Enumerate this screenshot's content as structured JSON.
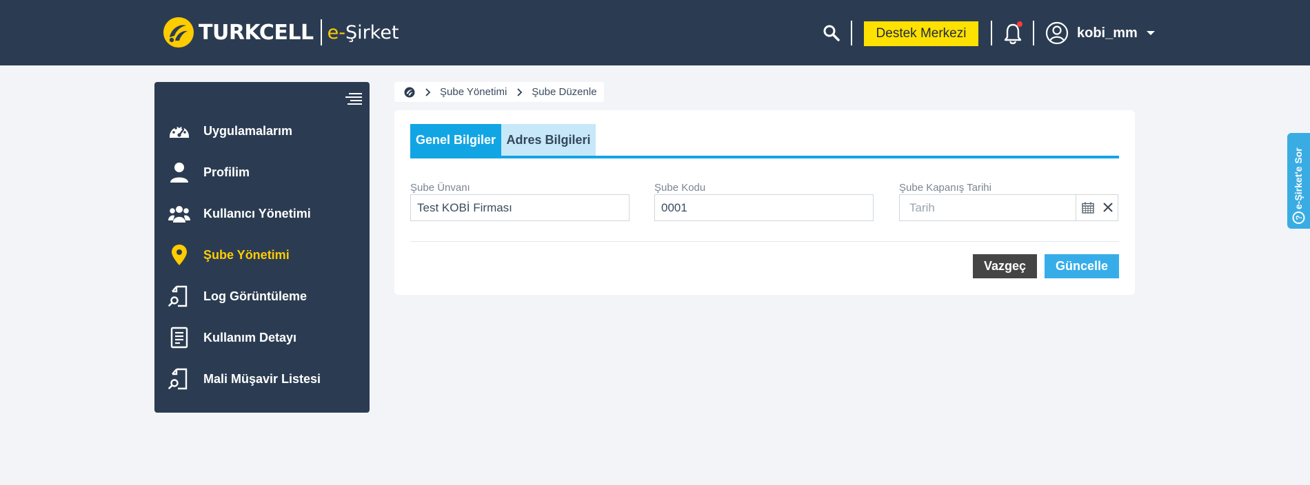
{
  "header": {
    "brand_name": "TURKCELL",
    "product_prefix": "e-",
    "product_name": "Şirket",
    "support_label": "Destek Merkezi",
    "username": "kobi_mm",
    "colors": {
      "background": "#2b3c52",
      "brand_yellow": "#ffcc00",
      "notification_dot": "#ff3b3b"
    },
    "icons": [
      "search-icon",
      "bell-icon",
      "user-icon",
      "caret-down-icon"
    ]
  },
  "sidebar": {
    "items": [
      {
        "label": "Uygulamalarım",
        "icon": "speedometer-icon",
        "active": false
      },
      {
        "label": "Profilim",
        "icon": "person-icon",
        "active": false
      },
      {
        "label": "Kullanıcı Yönetimi",
        "icon": "users-icon",
        "active": false
      },
      {
        "label": "Şube Yönetimi",
        "icon": "location-pin-icon",
        "active": true
      },
      {
        "label": "Log Görüntüleme",
        "icon": "document-search-icon",
        "active": false
      },
      {
        "label": "Kullanım Detayı",
        "icon": "list-document-icon",
        "active": false
      },
      {
        "label": "Mali Müşavir Listesi",
        "icon": "document-search-icon",
        "active": false
      }
    ]
  },
  "breadcrumb": {
    "items": [
      "Şube Yönetimi",
      "Şube Düzenle"
    ]
  },
  "tabs": [
    {
      "label": "Genel Bilgiler",
      "active": true
    },
    {
      "label": "Adres Bilgileri",
      "active": false
    }
  ],
  "form": {
    "branch_title": {
      "label": "Şube Ünvanı",
      "value": "Test KOBİ Firması"
    },
    "branch_code": {
      "label": "Şube Kodu",
      "value": "0001"
    },
    "closing_date": {
      "label": "Şube Kapanış Tarihi",
      "placeholder": "Tarih"
    }
  },
  "actions": {
    "cancel_label": "Vazgeç",
    "update_label": "Güncelle"
  },
  "side_tab": {
    "label": "e-Şirket'e Sor"
  }
}
